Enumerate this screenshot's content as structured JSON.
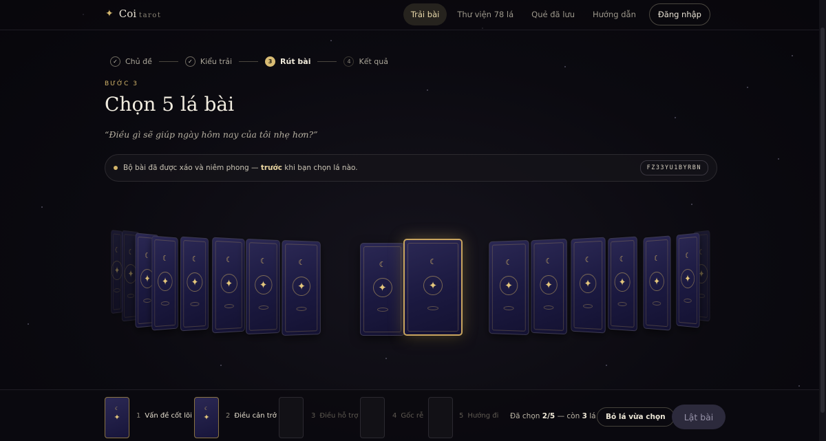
{
  "header": {
    "logo_main": "Coi",
    "logo_sub": "tarot",
    "nav": [
      {
        "label": "Trải bài",
        "active": true
      },
      {
        "label": "Thư viện 78 lá",
        "active": false
      },
      {
        "label": "Quẻ đã lưu",
        "active": false
      },
      {
        "label": "Hướng dẫn",
        "active": false
      }
    ],
    "login_label": "Đăng nhập"
  },
  "stepper": [
    {
      "label": "Chủ đề",
      "state": "done",
      "marker": "✓"
    },
    {
      "label": "Kiểu trải",
      "state": "done",
      "marker": "✓"
    },
    {
      "label": "Rút bài",
      "state": "current",
      "marker": "3"
    },
    {
      "label": "Kết quả",
      "state": "todo",
      "marker": "4"
    }
  ],
  "main": {
    "eyebrow": "BƯỚC 3",
    "title": "Chọn 5 lá bài",
    "quote": "“Điều gì sẽ giúp ngày hôm nay của tôi nhẹ hơn?”"
  },
  "notice": {
    "text_before": "Bộ bài đã được xáo và niêm phong — ",
    "text_emphasis": "trước",
    "text_after": " khi bạn chọn lá nào.",
    "seal_code": "FZ33YU1BYRBN"
  },
  "deck": {
    "card_icons": {
      "moon": "☾",
      "star": "✦"
    },
    "selected_count": 2
  },
  "tray": {
    "slots": [
      {
        "number": "1",
        "label": "Vấn đề cốt lõi",
        "filled": true
      },
      {
        "number": "2",
        "label": "Điều cản trở",
        "filled": true
      },
      {
        "number": "3",
        "label": "Điều hỗ trợ",
        "filled": false
      },
      {
        "number": "4",
        "label": "Gốc rễ",
        "filled": false
      },
      {
        "number": "5",
        "label": "Hướng đi",
        "filled": false
      }
    ],
    "picked_prefix": "Đã chọn",
    "picked_value": "2/5",
    "picked_mid": "— còn",
    "picked_remaining": "3",
    "picked_suffix": "lá",
    "undo_label": "Bỏ lá vừa chọn",
    "flip_label": "Lật bài"
  },
  "colors": {
    "accent_gold": "#d4b56a",
    "card_back": "#1b1940",
    "background": "#0b0a10"
  }
}
